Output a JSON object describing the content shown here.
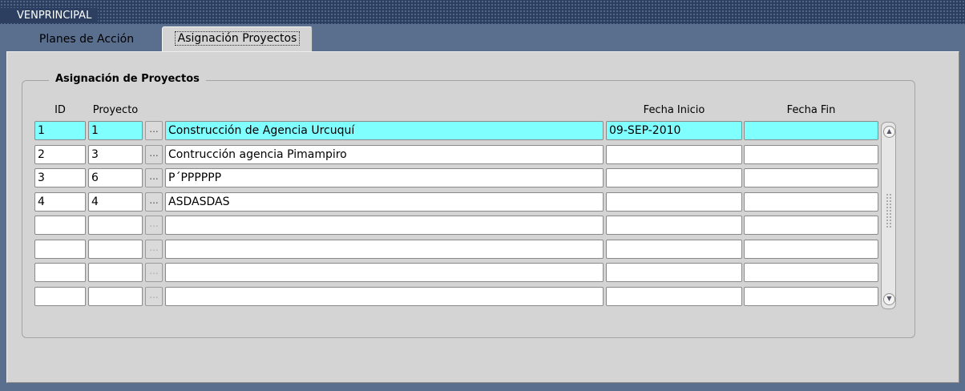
{
  "window": {
    "title": "VENPRINCIPAL",
    "icon": "oracle-forms-icon"
  },
  "tabs": [
    {
      "label": "Planes de Acción",
      "active": false
    },
    {
      "label": "Asignación Proyectos",
      "active": true
    }
  ],
  "frame": {
    "title": "Asignación de Proyectos",
    "columns": {
      "id": "ID",
      "proyecto": "Proyecto",
      "descripcion": "",
      "fecha_inicio": "Fecha Inicio",
      "fecha_fin": "Fecha Fin"
    },
    "lov_label": "...",
    "rows": [
      {
        "id": "1",
        "proyecto": "1",
        "descripcion": "Construcción de Agencia Urcuquí",
        "fecha_inicio": "09-SEP-2010",
        "fecha_fin": "",
        "selected": true
      },
      {
        "id": "2",
        "proyecto": "3",
        "descripcion": "Contrucción agencia Pimampiro",
        "fecha_inicio": "",
        "fecha_fin": ""
      },
      {
        "id": "3",
        "proyecto": "6",
        "descripcion": "P´PPPPPP",
        "fecha_inicio": "",
        "fecha_fin": ""
      },
      {
        "id": "4",
        "proyecto": "4",
        "descripcion": "ASDASDAS",
        "fecha_inicio": "",
        "fecha_fin": ""
      },
      {
        "id": "",
        "proyecto": "",
        "descripcion": "",
        "fecha_inicio": "",
        "fecha_fin": ""
      },
      {
        "id": "",
        "proyecto": "",
        "descripcion": "",
        "fecha_inicio": "",
        "fecha_fin": ""
      },
      {
        "id": "",
        "proyecto": "",
        "descripcion": "",
        "fecha_inicio": "",
        "fecha_fin": ""
      },
      {
        "id": "",
        "proyecto": "",
        "descripcion": "",
        "fecha_inicio": "",
        "fecha_fin": ""
      }
    ]
  },
  "colors": {
    "selected_row": "#80ffff",
    "panel": "#d4d4d4",
    "titlebar": "#2c3f60"
  }
}
